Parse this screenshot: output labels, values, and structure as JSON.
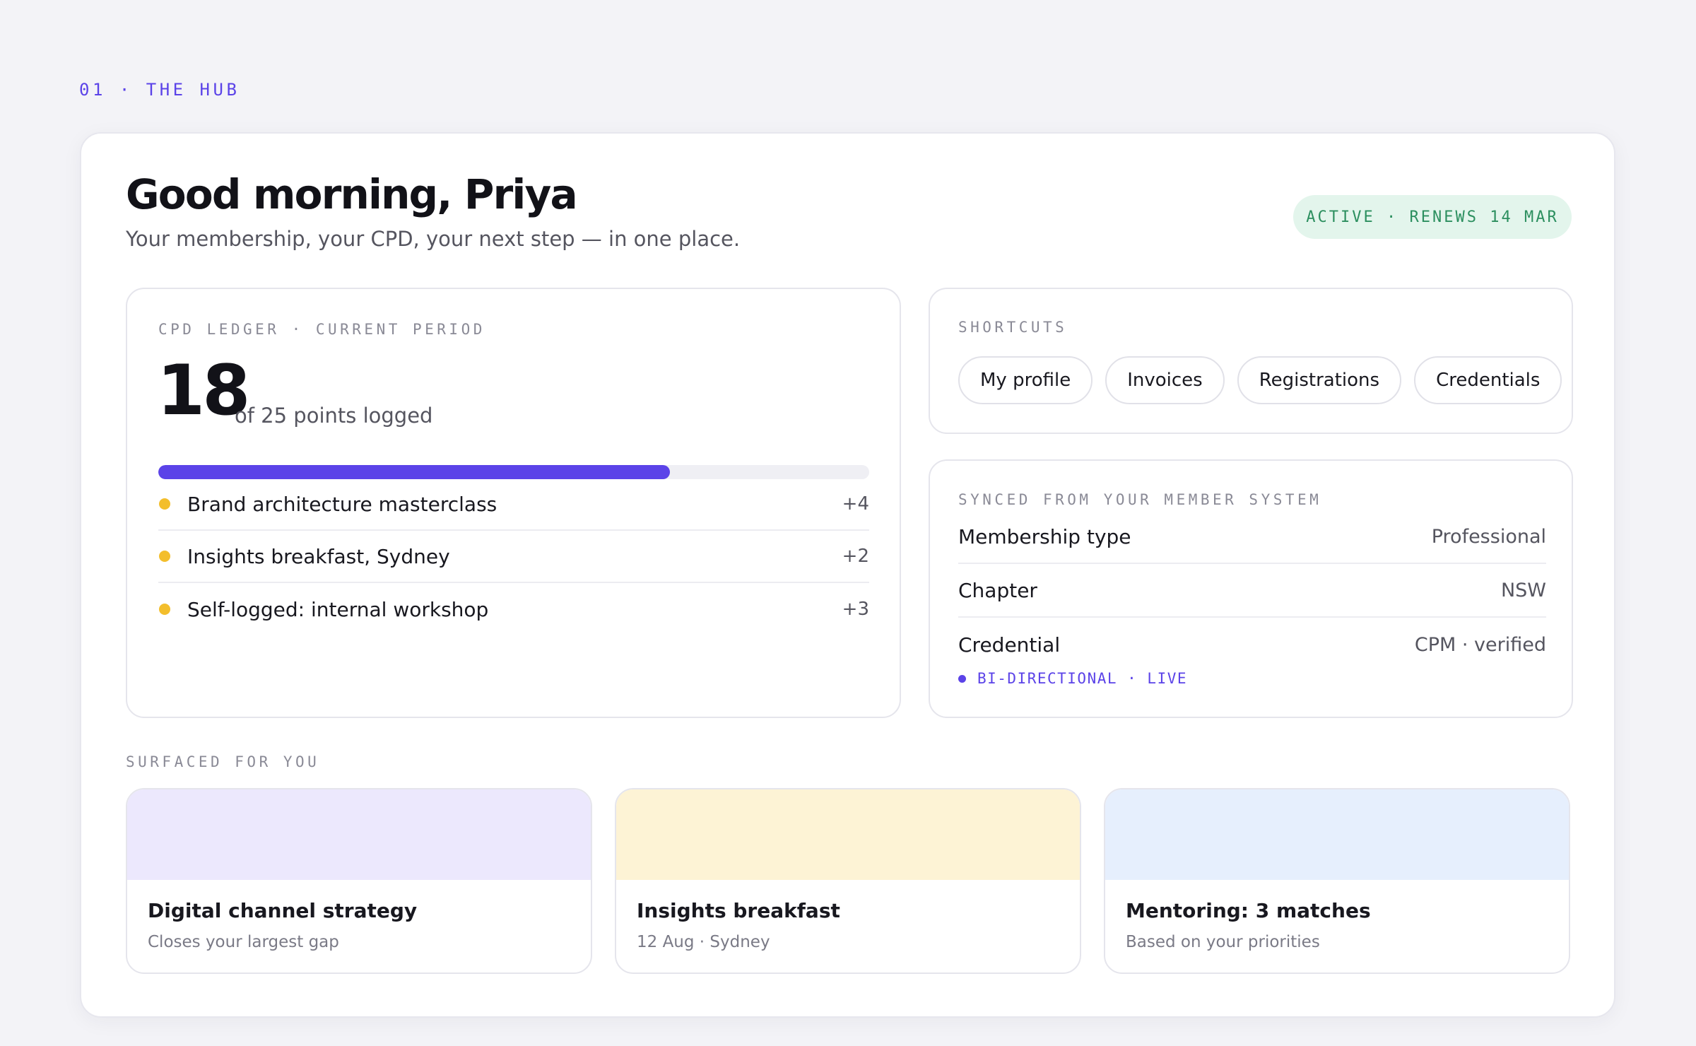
{
  "section_tag": "01 · THE HUB",
  "header": {
    "greeting": "Good morning, Priya",
    "subtitle": "Your membership, your CPD, your next step — in one place.",
    "status_badge": "ACTIVE · RENEWS 14 MAR"
  },
  "cpd": {
    "eyebrow": "CPD LEDGER · CURRENT PERIOD",
    "points_logged": "18",
    "caption": "of 25 points logged",
    "progress_fraction": 0.72,
    "entries": [
      {
        "label": "Brand architecture masterclass",
        "points": "+4"
      },
      {
        "label": "Insights breakfast, Sydney",
        "points": "+2"
      },
      {
        "label": "Self-logged: internal workshop",
        "points": "+3"
      }
    ]
  },
  "shortcuts": {
    "eyebrow": "SHORTCUTS",
    "items": [
      "My profile",
      "Invoices",
      "Registrations",
      "Credentials"
    ]
  },
  "synced": {
    "eyebrow": "SYNCED FROM YOUR MEMBER SYSTEM",
    "rows": [
      {
        "key": "Membership type",
        "value": "Professional"
      },
      {
        "key": "Chapter",
        "value": "NSW"
      },
      {
        "key": "Credential",
        "value": "CPM · verified"
      }
    ],
    "status": "BI-DIRECTIONAL · LIVE"
  },
  "surfaced": {
    "eyebrow": "SURFACED FOR YOU",
    "cards": [
      {
        "title": "Digital channel strategy",
        "subtitle": "Closes your largest gap",
        "color": "#ece8fd"
      },
      {
        "title": "Insights breakfast",
        "subtitle": "12 Aug · Sydney",
        "color": "#fdf3d5"
      },
      {
        "title": "Mentoring: 3 matches",
        "subtitle": "Based on your priorities",
        "color": "#e6effd"
      }
    ]
  },
  "colors": {
    "accent": "#5b43e8",
    "status_green_bg": "#e3f5ec",
    "status_green_text": "#2c8f5f",
    "ledger_dot": "#f3be2c"
  }
}
